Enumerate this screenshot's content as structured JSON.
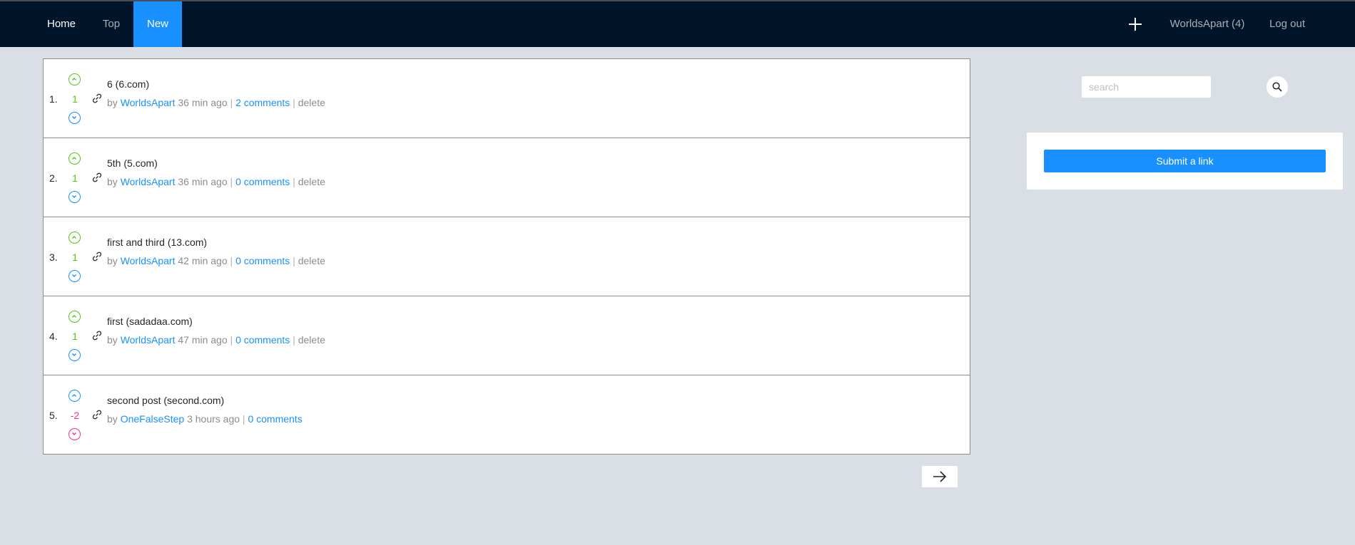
{
  "nav": {
    "home": "Home",
    "top": "Top",
    "new": "New",
    "active_tab": "New",
    "plus_icon": "plus-icon",
    "user": "WorldsApart (4)",
    "logout": "Log out"
  },
  "colors": {
    "nav_bg": "#001529",
    "accent": "#1890ff",
    "upvoted": "#52c41a",
    "downvoted": "#eb2f96",
    "page_bg": "#dadfe6"
  },
  "posts": [
    {
      "rank": "1.",
      "score": "1",
      "vote_state": "up",
      "title": "6 (6.com)",
      "by": "by",
      "author": "WorldsApart",
      "time": "36 min ago",
      "comments": "2 comments",
      "delete": "delete"
    },
    {
      "rank": "2.",
      "score": "1",
      "vote_state": "up",
      "title": "5th (5.com)",
      "by": "by",
      "author": "WorldsApart",
      "time": "36 min ago",
      "comments": "0 comments",
      "delete": "delete"
    },
    {
      "rank": "3.",
      "score": "1",
      "vote_state": "up",
      "title": "first and third (13.com)",
      "by": "by",
      "author": "WorldsApart",
      "time": "42 min ago",
      "comments": "0 comments",
      "delete": "delete"
    },
    {
      "rank": "4.",
      "score": "1",
      "vote_state": "up",
      "title": "first (sadadaa.com)",
      "by": "by",
      "author": "WorldsApart",
      "time": "47 min ago",
      "comments": "0 comments",
      "delete": "delete"
    },
    {
      "rank": "5.",
      "score": "-2",
      "vote_state": "down",
      "title": "second post (second.com)",
      "by": "by",
      "author": "OneFalseStep",
      "time": "3 hours ago",
      "comments": "0 comments",
      "delete": null
    }
  ],
  "pagination": {
    "next_icon": "arrow-right-icon"
  },
  "sidebar": {
    "search_placeholder": "search",
    "search_value": "",
    "search_icon": "search-icon",
    "submit_label": "Submit a link"
  }
}
